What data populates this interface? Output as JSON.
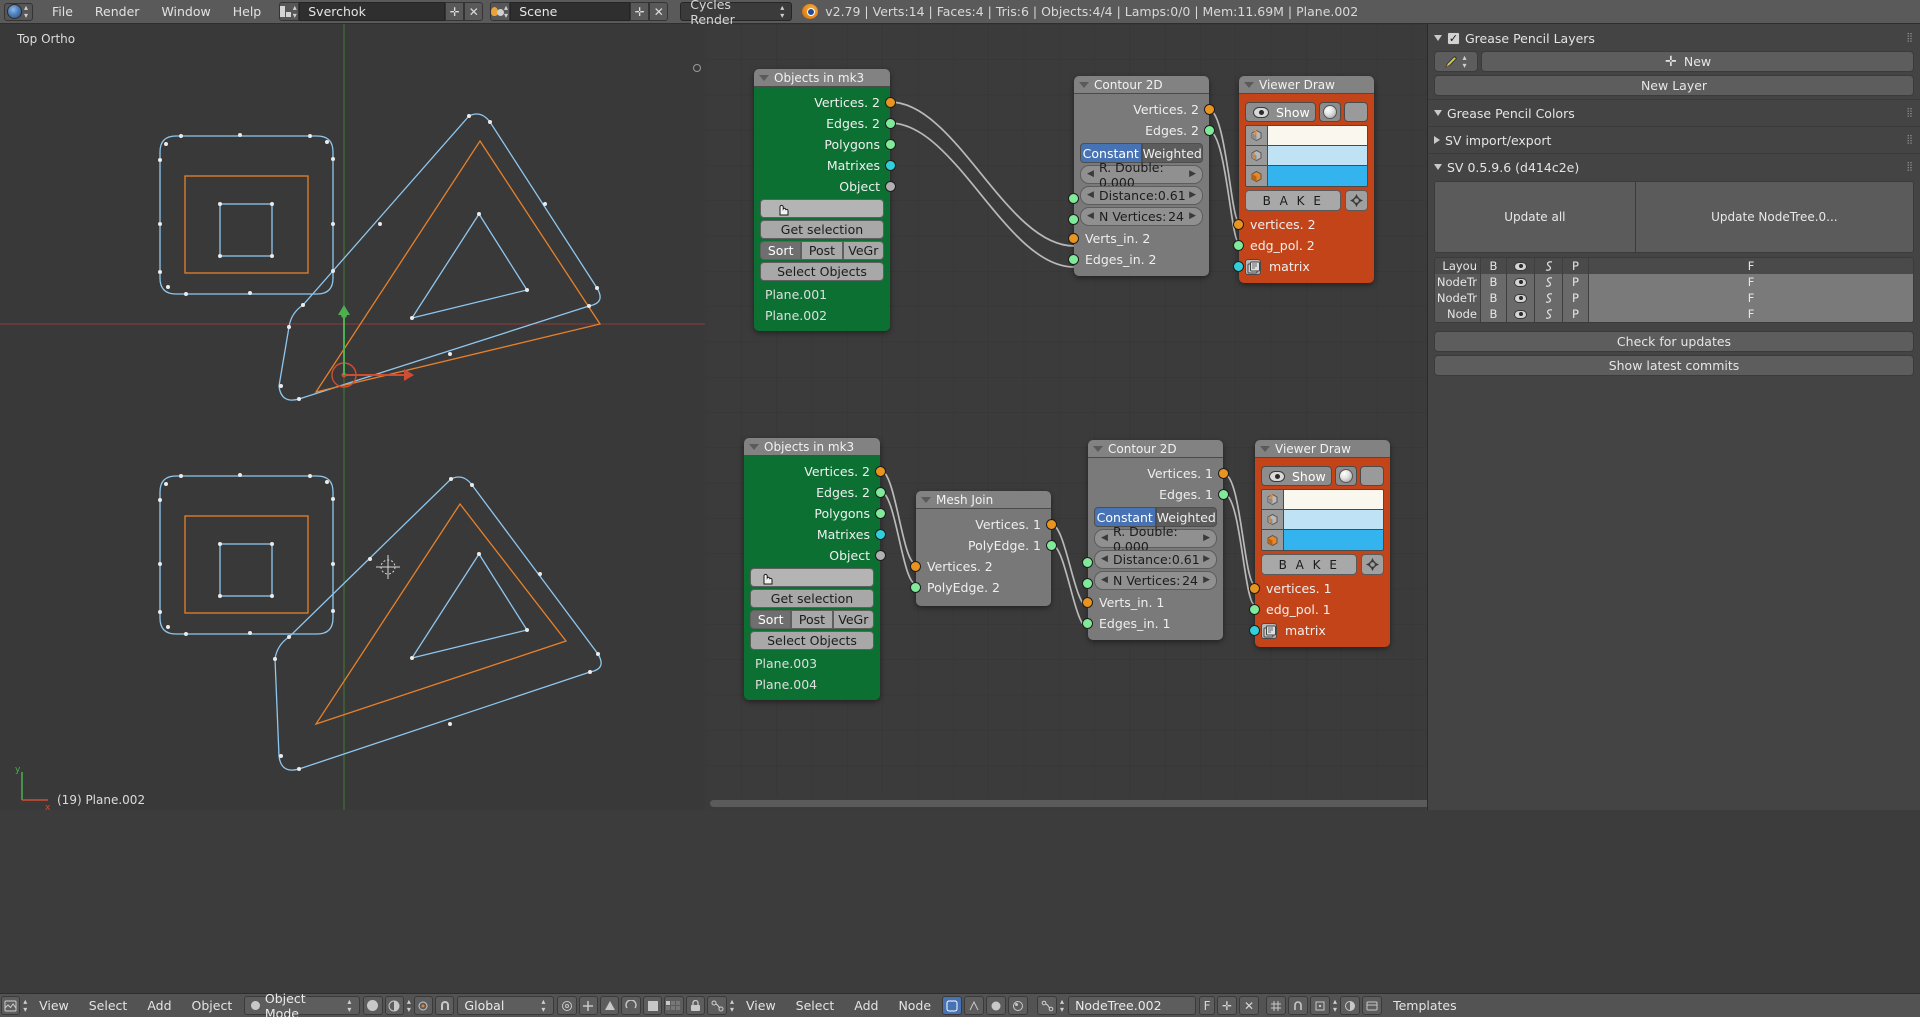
{
  "topbar": {
    "menus": [
      "File",
      "Render",
      "Window",
      "Help"
    ],
    "screen_layout": "Sverchok",
    "scene": "Scene",
    "engine": "Cycles Render",
    "status": "v2.79 | Verts:14 | Faces:4 | Tris:6 | Objects:4/4 | Lamps:0/0 | Mem:11.69M | Plane.002"
  },
  "viewport": {
    "view_label": "Top Ortho",
    "object_label": "(19) Plane.002",
    "axis_x": "x",
    "axis_y": "y"
  },
  "nodes": {
    "objects_in_top": {
      "title": "Objects in mk3",
      "outputs": [
        {
          "label": "Vertices. 2",
          "socket": "vertices-socket"
        },
        {
          "label": "Edges. 2",
          "socket": "edges-socket"
        },
        {
          "label": "Polygons",
          "socket": "polygons-socket"
        },
        {
          "label": "Matrixes",
          "socket": "matrixes-socket"
        },
        {
          "label": "Object",
          "socket": "object-socket"
        }
      ],
      "blank_button": "",
      "get_selection": "Get selection",
      "tabs": [
        "Sort",
        "Post",
        "VeGr"
      ],
      "tab_selected": "Sort",
      "select_objects": "Select Objects",
      "object_list": [
        "Plane.001",
        "Plane.002"
      ]
    },
    "contour2d_top": {
      "title": "Contour 2D",
      "outputs": [
        {
          "label": "Vertices. 2",
          "socket": "vertices-socket"
        },
        {
          "label": "Edges. 2",
          "socket": "edges-socket"
        }
      ],
      "mode_options": [
        "Constant",
        "Weighted"
      ],
      "mode_selected": "Constant",
      "r_double": "R. Double: 0.000",
      "distance_label": "Distance:",
      "distance_value": "0.61",
      "nvertices_label": "N Vertices:",
      "nvertices_value": "24",
      "inputs": [
        {
          "label": "Verts_in. 2",
          "socket": "verts-in-socket"
        },
        {
          "label": "Edges_in. 2",
          "socket": "edges-in-socket"
        }
      ]
    },
    "viewer_draw_top": {
      "title": "Viewer Draw",
      "show_label": "Show",
      "colors": [
        "#faf7ef",
        "#bfe2f5",
        "#34b4ef"
      ],
      "bake_label": "B A K E",
      "inputs": [
        {
          "label": "vertices. 2",
          "socket": "vertices-socket"
        },
        {
          "label": "edg_pol. 2",
          "socket": "edgepol-socket"
        },
        {
          "label": "matrix",
          "socket": "matrix-socket"
        }
      ]
    },
    "objects_in_bottom": {
      "title": "Objects in mk3",
      "outputs": [
        {
          "label": "Vertices. 2",
          "socket": "vertices-socket"
        },
        {
          "label": "Edges. 2",
          "socket": "edges-socket"
        },
        {
          "label": "Polygons",
          "socket": "polygons-socket"
        },
        {
          "label": "Matrixes",
          "socket": "matrixes-socket"
        },
        {
          "label": "Object",
          "socket": "object-socket"
        }
      ],
      "blank_button": "",
      "get_selection": "Get selection",
      "tabs": [
        "Sort",
        "Post",
        "VeGr"
      ],
      "tab_selected": "Sort",
      "select_objects": "Select Objects",
      "object_list": [
        "Plane.003",
        "Plane.004"
      ]
    },
    "mesh_join": {
      "title": "Mesh Join",
      "outputs": [
        {
          "label": "Vertices. 1",
          "socket": "vertices-socket"
        },
        {
          "label": "PolyEdge. 1",
          "socket": "polyedge-socket"
        }
      ],
      "inputs": [
        {
          "label": "Vertices. 2",
          "socket": "vertices-socket"
        },
        {
          "label": "PolyEdge. 2",
          "socket": "polyedge-socket"
        }
      ]
    },
    "contour2d_bottom": {
      "title": "Contour 2D",
      "outputs": [
        {
          "label": "Vertices. 1",
          "socket": "vertices-socket"
        },
        {
          "label": "Edges. 1",
          "socket": "edges-socket"
        }
      ],
      "mode_options": [
        "Constant",
        "Weighted"
      ],
      "mode_selected": "Constant",
      "r_double": "R. Double: 0.000",
      "distance_label": "Distance:",
      "distance_value": "0.61",
      "nvertices_label": "N Vertices:",
      "nvertices_value": "24",
      "inputs": [
        {
          "label": "Verts_in. 1",
          "socket": "verts-in-socket"
        },
        {
          "label": "Edges_in. 1",
          "socket": "edges-in-socket"
        }
      ]
    },
    "viewer_draw_bottom": {
      "title": "Viewer Draw",
      "show_label": "Show",
      "colors": [
        "#faf7ef",
        "#bfe2f5",
        "#34b4ef"
      ],
      "bake_label": "B A K E",
      "inputs": [
        {
          "label": "vertices. 1",
          "socket": "vertices-socket"
        },
        {
          "label": "edg_pol. 1",
          "socket": "edgepol-socket"
        },
        {
          "label": "matrix",
          "socket": "matrix-socket"
        }
      ]
    }
  },
  "properties": {
    "grease_pencil_layers": {
      "title": "Grease Pencil Layers",
      "checked": true,
      "new_button": "New",
      "new_layer_button": "New Layer"
    },
    "grease_pencil_colors": {
      "title": "Grease Pencil Colors"
    },
    "sv_import_export": {
      "title": "SV import/export"
    },
    "sv_version": {
      "title": "SV 0.5.9.6 (d414c2e)"
    },
    "update_buttons": [
      "Update all",
      "Update NodeTree.0..."
    ],
    "tree_table": {
      "headers": [
        "Layou",
        "B",
        "eye-icon",
        "snake-icon",
        "P",
        "F"
      ],
      "rows": [
        [
          "NodeTr",
          "B",
          "eye-icon",
          "snake-icon",
          "P",
          "F"
        ],
        [
          "NodeTr",
          "B",
          "eye-icon",
          "snake-icon",
          "P",
          "F"
        ],
        [
          "Node",
          "B",
          "eye-icon",
          "snake-icon",
          "P",
          "F"
        ]
      ]
    },
    "check_updates": "Check for updates",
    "show_commits": "Show latest commits"
  },
  "bottom_viewport_bar": {
    "menus": [
      "View",
      "Select",
      "Add",
      "Object"
    ],
    "mode": "Object Mode",
    "transform_orientation": "Global"
  },
  "bottom_node_bar": {
    "menus": [
      "View",
      "Select",
      "Add",
      "Node"
    ],
    "tree_name": "NodeTree.002",
    "f_label": "F",
    "templates": "Templates"
  },
  "colors": {
    "node_green": "#0d7033",
    "node_orange": "#c4441a",
    "socket_vertices": "#e8941f",
    "socket_edges": "#80e99a",
    "socket_matrix": "#2fd0dc",
    "socket_object": "#b0b0b0",
    "accent_blue": "#4772b3",
    "mesh_blue": "#8fc7ee",
    "mesh_orange": "#e8802a"
  }
}
